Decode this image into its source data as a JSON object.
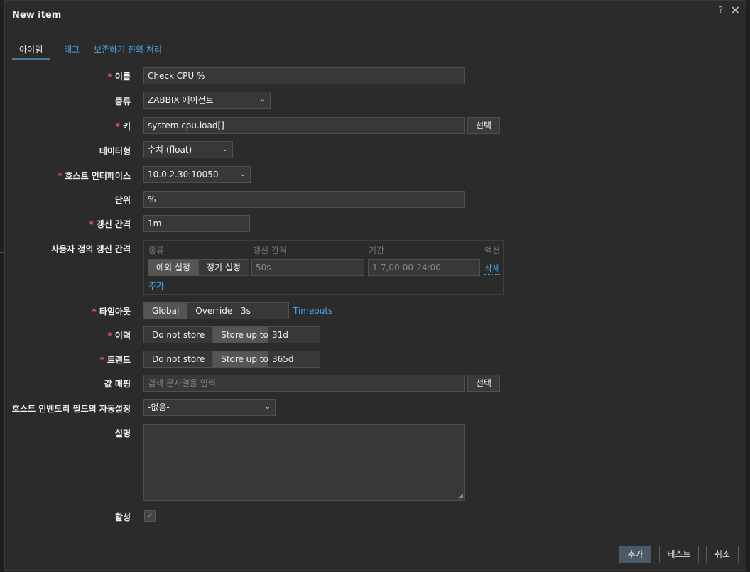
{
  "dialog": {
    "title": "New item",
    "help": "?",
    "close": "✕"
  },
  "tabs": [
    {
      "label": "아이템"
    },
    {
      "label": "태그"
    },
    {
      "label": "보존하기 전의 처리"
    }
  ],
  "form": {
    "name": {
      "label": "이름",
      "value": "Check CPU %"
    },
    "type": {
      "label": "종류",
      "value": "ZABBIX 에이전트"
    },
    "key": {
      "label": "키",
      "value": "system.cpu.load[]",
      "button": "선택"
    },
    "value_type": {
      "label": "데이터형",
      "value": "수치 (float)"
    },
    "interface": {
      "label": "호스트 인터페이스",
      "value": "10.0.2.30:10050"
    },
    "units": {
      "label": "단위",
      "value": "%"
    },
    "interval": {
      "label": "갱신 간격",
      "value": "1m"
    },
    "custom_intervals": {
      "label": "사용자 정의 갱신 간격",
      "col_type": "종류",
      "col_interval": "갱신 간격",
      "col_period": "기간",
      "col_action": "액션",
      "seg_flexible": "예외 설정",
      "seg_scheduling": "정기 설정",
      "interval_placeholder": "50s",
      "period_placeholder": "1-7,00:00-24:00",
      "remove": "삭제",
      "add": "추가"
    },
    "timeout": {
      "label": "타임아웃",
      "seg_global": "Global",
      "seg_override": "Override",
      "value": "3s",
      "link": "Timeouts"
    },
    "history": {
      "label": "이력",
      "seg_no": "Do not store",
      "seg_yes": "Store up to",
      "value": "31d"
    },
    "trends": {
      "label": "트렌드",
      "seg_no": "Do not store",
      "seg_yes": "Store up to",
      "value": "365d"
    },
    "valuemap": {
      "label": "값 매핑",
      "placeholder": "검색 문자열을 입력",
      "button": "선택"
    },
    "inventory": {
      "label": "호스트 인벤토리 필드의 자동설정",
      "value": "-없음-"
    },
    "description": {
      "label": "설명"
    },
    "enabled": {
      "label": "활성",
      "check": "✓"
    }
  },
  "footer": {
    "add": "추가",
    "test": "테스트",
    "cancel": "취소"
  },
  "required_mark": "*",
  "chevron": "⌄",
  "colors": {
    "accent": "#4aa6e8",
    "required": "#e45959",
    "background": "#2b2b2b"
  }
}
